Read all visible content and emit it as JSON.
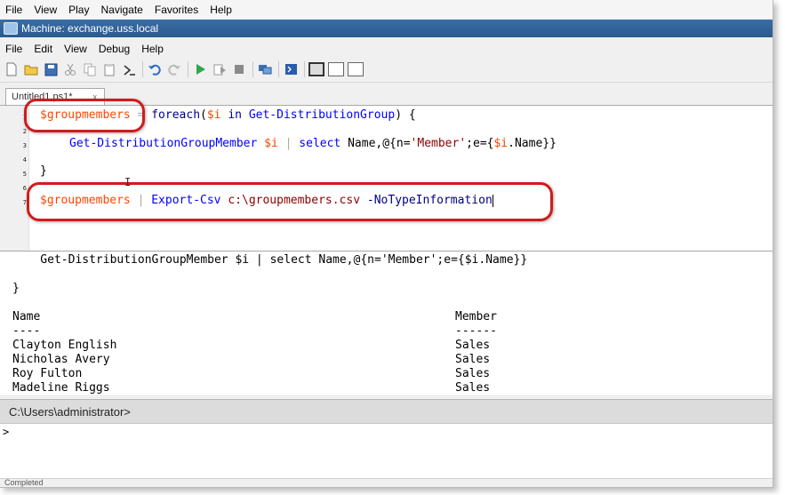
{
  "host_menu": [
    "File",
    "View",
    "Play",
    "Navigate",
    "Favorites",
    "Help"
  ],
  "window_title": "Machine: exchange.uss.local",
  "app_menu": [
    "File",
    "Edit",
    "View",
    "Debug",
    "Help"
  ],
  "toolbar_icons": [
    "new-icon",
    "open-icon",
    "save-icon",
    "cut-icon",
    "copy-icon",
    "paste-icon",
    "powershell-icon",
    "undo-icon",
    "redo-icon",
    "run-icon",
    "run-selection-icon",
    "stop-icon",
    "remote-icon",
    "console-icon",
    "layout-top-icon",
    "layout-right-icon",
    "layout-max-icon"
  ],
  "tab": {
    "label": "Untitled1.ps1*",
    "close": "x"
  },
  "editor": {
    "line_numbers": [
      "1",
      "2",
      "3",
      "4",
      "5",
      "6",
      "7"
    ],
    "line1": {
      "var": "$groupmembers",
      "eq": " = ",
      "kw": "foreach",
      "open": "(",
      "var2": "$i",
      "in": " in ",
      "cmd": "Get-DistributionGroup",
      "close": ") {"
    },
    "line3": {
      "cmd": "Get-DistributionGroupMember",
      "sp": " ",
      "var": "$i",
      "pipe": " | ",
      "select": "select",
      "rest1": " Name,@{n=",
      "str": "'Member'",
      "rest2": ";e={",
      "var2": "$i",
      "rest3": ".Name}}"
    },
    "line5": "}",
    "line7": {
      "var": "$groupmembers",
      "pipe": " | ",
      "cmd": "Export-Csv",
      "path": " c:\\groupmembers.csv",
      "param": " -NoTypeInformation"
    }
  },
  "output": {
    "cmd_echo": "    Get-DistributionGroupMember $i | select Name,@{n='Member';e={$i.Name}}",
    "close_brace": "}",
    "col_name": "Name",
    "col_member": "Member",
    "sep_name": "----",
    "sep_member": "------",
    "rows": [
      {
        "name": "Clayton English",
        "member": "Sales"
      },
      {
        "name": "Nicholas Avery",
        "member": "Sales"
      },
      {
        "name": "Roy Fulton",
        "member": "Sales"
      },
      {
        "name": "Madeline Riggs",
        "member": "Sales"
      }
    ]
  },
  "command_pane": {
    "path": "C:\\Users\\administrator>",
    "prompt": ">"
  },
  "status": {
    "text": "Completed"
  },
  "colors": {
    "highlight": "#d11b1b",
    "variable": "#ff4500",
    "keyword": "#00008b",
    "cmdlet": "#0000ff",
    "string": "#8b0000"
  }
}
